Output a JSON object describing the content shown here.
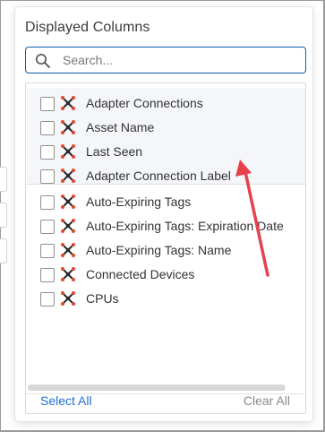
{
  "panel": {
    "title": "Displayed Columns",
    "search": {
      "placeholder": "Search...",
      "value": ""
    },
    "selected_columns": [
      {
        "label": "Adapter Connections"
      },
      {
        "label": "Asset Name"
      },
      {
        "label": "Last Seen"
      },
      {
        "label": "Adapter Connection Label"
      }
    ],
    "available_columns": [
      {
        "label": "Auto-Expiring Tags"
      },
      {
        "label": "Auto-Expiring Tags: Expiration Date"
      },
      {
        "label": "Auto-Expiring Tags: Name"
      },
      {
        "label": "Connected Devices"
      },
      {
        "label": "CPUs"
      }
    ],
    "footer": {
      "select_all": "Select All",
      "clear_all": "Clear All"
    },
    "colors": {
      "accent": "#1f6fd1",
      "search_border": "#0a5fa8",
      "column_icon": "#e0492e",
      "annotation_arrow": "#e5424d"
    },
    "icons": {
      "search": "search-icon",
      "column": "column-type-icon"
    }
  }
}
